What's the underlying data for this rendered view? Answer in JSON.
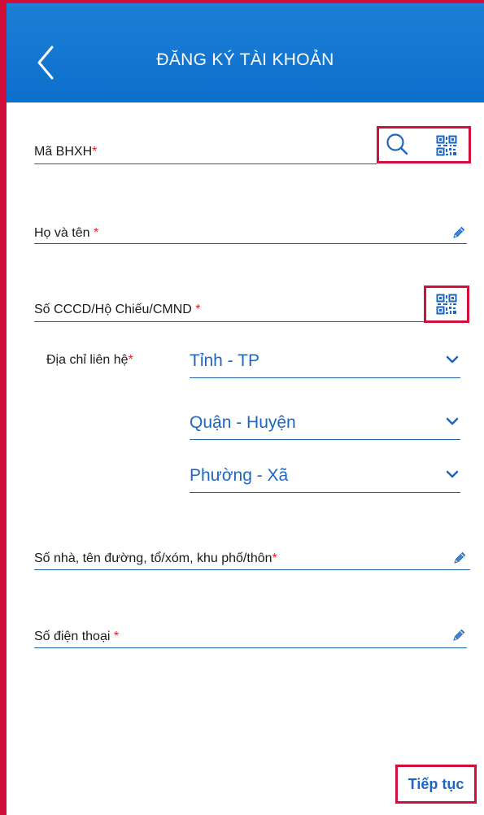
{
  "header": {
    "title": "ĐĂNG KÝ TÀI KHOẢN",
    "back_icon": "chevron-left-icon"
  },
  "form": {
    "bhxh": {
      "label": "Mã BHXH",
      "required_mark": "*",
      "icons": [
        "search-icon",
        "qr-code-icon"
      ]
    },
    "full_name": {
      "label": "Họ và tên ",
      "required_mark": "*",
      "icon": "pencil-icon"
    },
    "id_number": {
      "label": "Số CCCD/Hộ Chiếu/CMND ",
      "required_mark": "*",
      "icon": "qr-code-icon"
    },
    "address": {
      "label": "Địa chỉ liên hệ",
      "required_mark": "*",
      "province": "Tỉnh - TP",
      "district": "Quận - Huyện",
      "ward": "Phường - Xã",
      "chevron_icon": "chevron-down-icon"
    },
    "street": {
      "label": "Số nhà, tên đường, tổ/xóm, khu phố/thôn",
      "required_mark": "*",
      "icon": "pencil-icon"
    },
    "phone": {
      "label": "Số điện thoại ",
      "required_mark": "*",
      "icon": "pencil-icon"
    }
  },
  "footer": {
    "continue_label": "Tiếp tục"
  },
  "colors": {
    "header_bg": "#0c6fcc",
    "accent_blue": "#1d66c2",
    "required_red": "#e0202a",
    "highlight_red": "#d0103a"
  }
}
